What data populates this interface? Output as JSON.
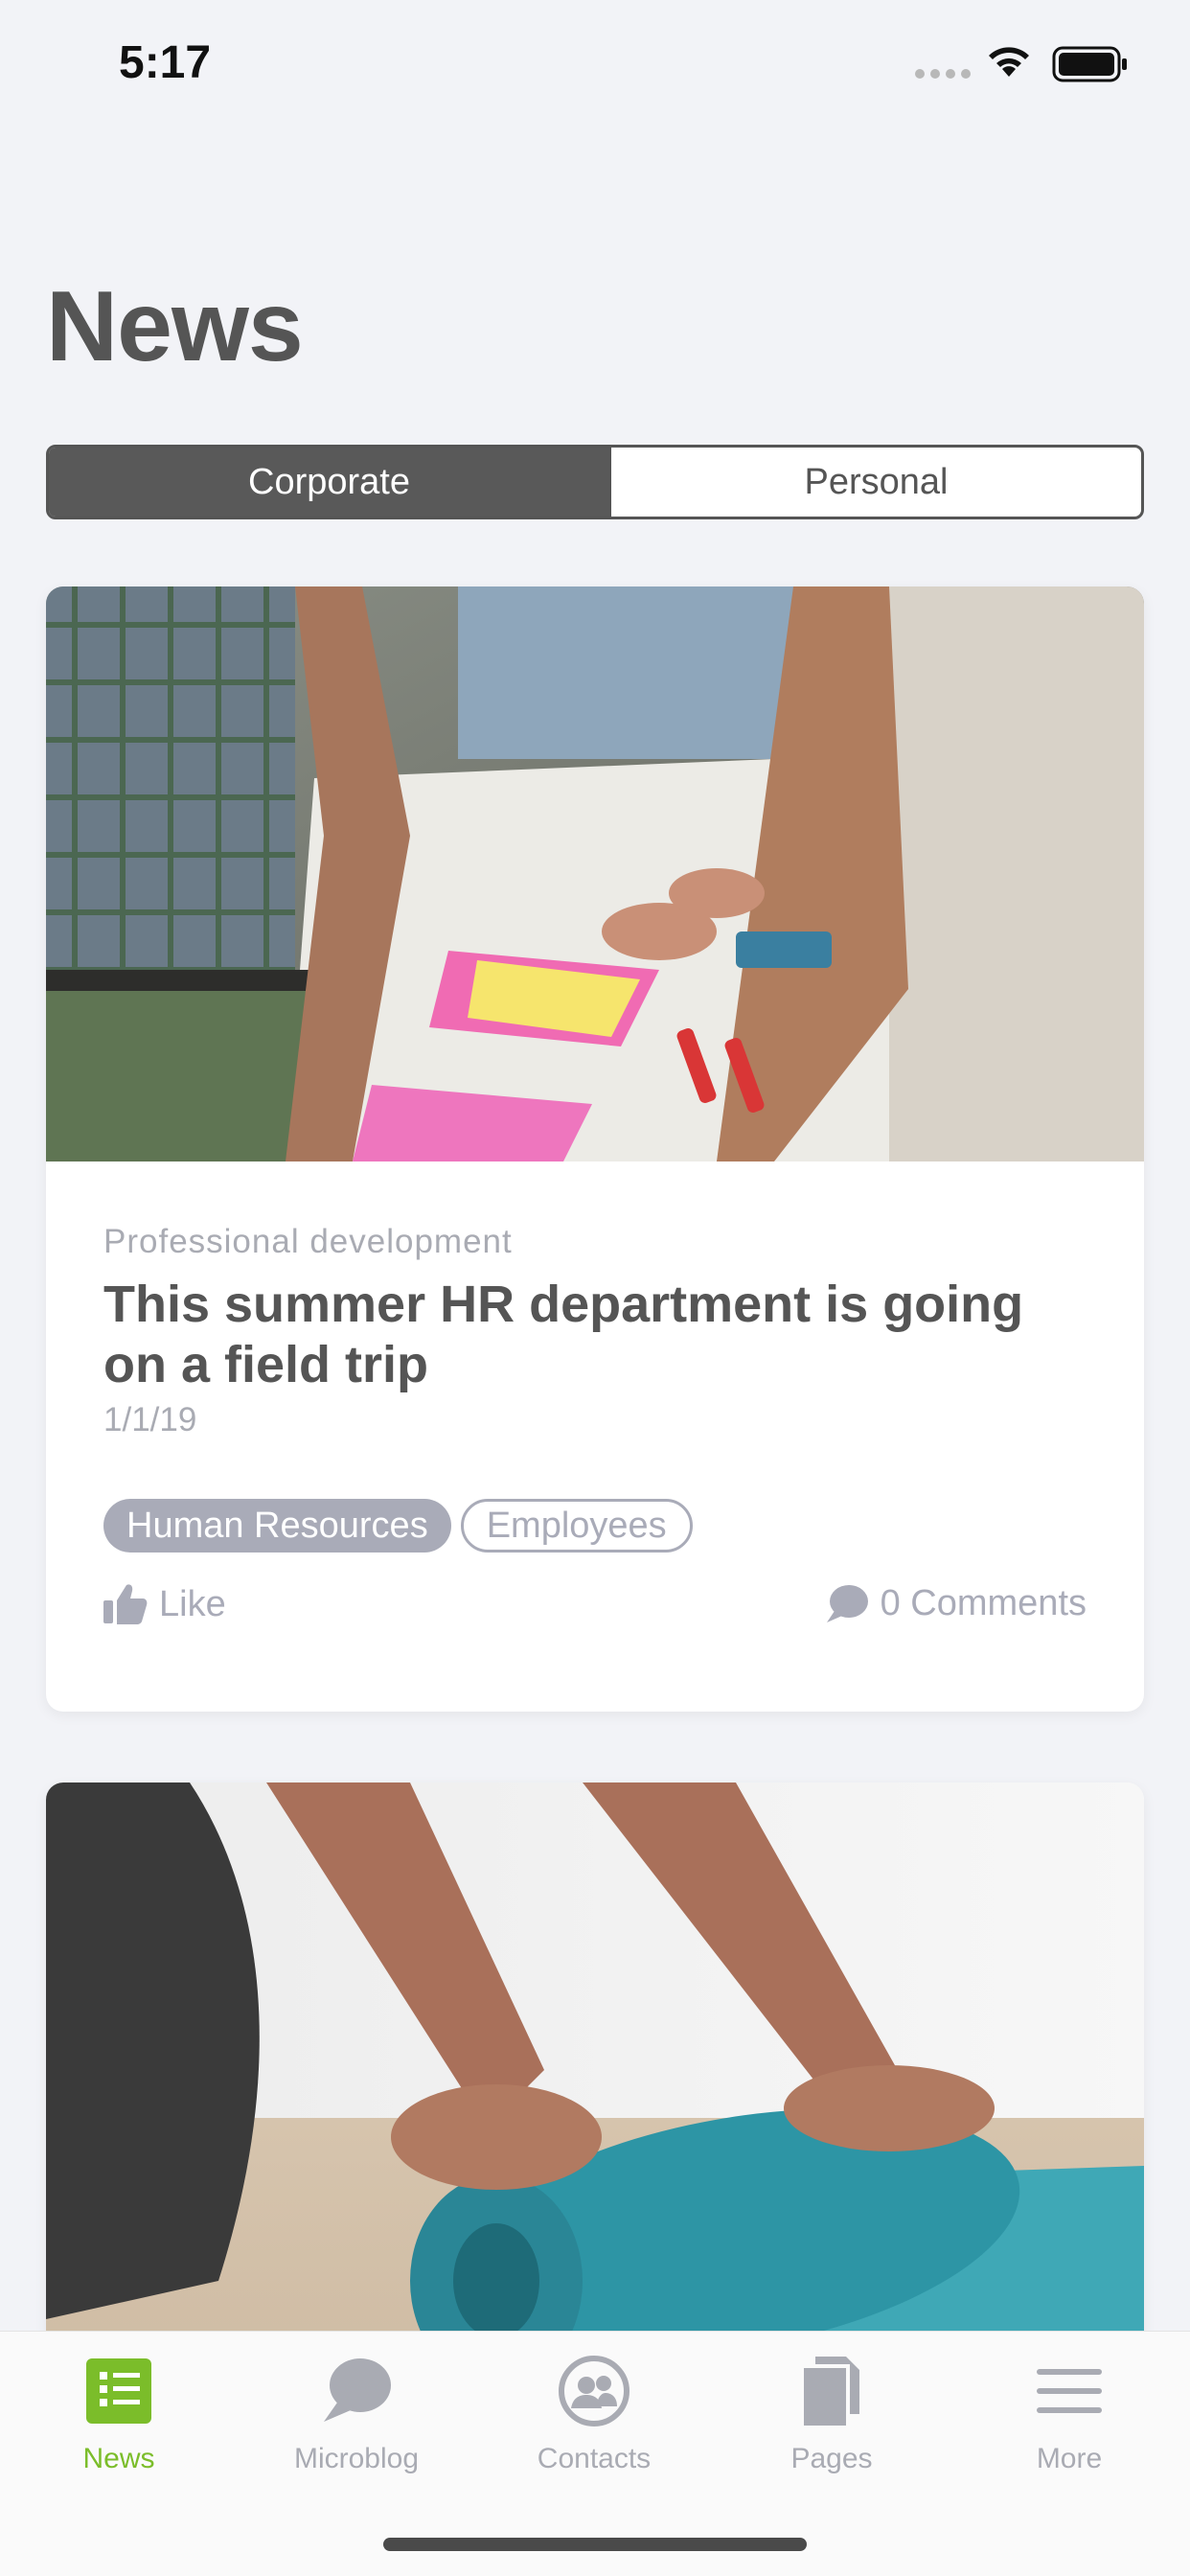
{
  "status_bar": {
    "time": "5:17"
  },
  "page_title": "News",
  "segmented": {
    "corporate_label": "Corporate",
    "personal_label": "Personal",
    "selected": "Corporate"
  },
  "cards": [
    {
      "category": "Professional development",
      "headline": "This summer HR department is going on a field trip",
      "date": "1/1/19",
      "tags": [
        "Human Resources",
        "Employees"
      ],
      "like_label": "Like",
      "comments_label": "0 Comments"
    },
    {
      "category": "",
      "headline": ""
    }
  ],
  "tab_bar": {
    "tabs": [
      {
        "label": "News",
        "icon": "news-icon",
        "active": true
      },
      {
        "label": "Microblog",
        "icon": "microblog-icon",
        "active": false
      },
      {
        "label": "Contacts",
        "icon": "contacts-icon",
        "active": false
      },
      {
        "label": "Pages",
        "icon": "pages-icon",
        "active": false
      },
      {
        "label": "More",
        "icon": "more-icon",
        "active": false
      }
    ]
  },
  "colors": {
    "accent": "#7bbd2a",
    "muted": "#a9abb3",
    "text": "#555555",
    "background": "#f2f3f7"
  }
}
